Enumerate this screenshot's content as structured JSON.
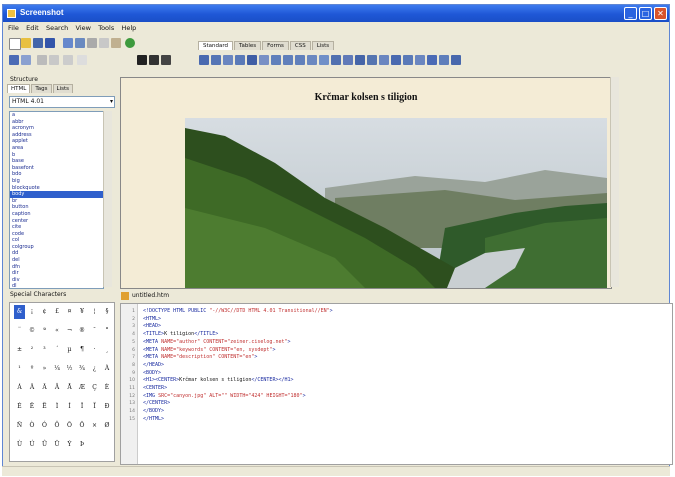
{
  "window": {
    "title": "Screenshot"
  },
  "menu": [
    "File",
    "Edit",
    "Search",
    "View",
    "Tools",
    "Help"
  ],
  "toolbar_tabs": {
    "labels": [
      "Standard",
      "Tables",
      "Forms",
      "CSS",
      "Lists"
    ],
    "active": 0
  },
  "left_panel": {
    "header": "Structure",
    "tabs": [
      "HTML",
      "Tags",
      "Lists"
    ],
    "dropdown_value": "HTML 4.01",
    "tags": [
      "a",
      "abbr",
      "acronym",
      "address",
      "applet",
      "area",
      "b",
      "base",
      "basefont",
      "bdo",
      "big",
      "blockquote",
      "body",
      "br",
      "button",
      "caption",
      "center",
      "cite",
      "code",
      "col",
      "colgroup",
      "dd",
      "del",
      "dfn",
      "dir",
      "div",
      "dl",
      "dt",
      "em",
      "fieldset",
      "font"
    ],
    "selected_index": 12
  },
  "editor": {
    "heading": "Krčmar kolsen s tiligion"
  },
  "char_panel": {
    "header": "Special Characters",
    "chars": [
      "&",
      "¡",
      "¢",
      "£",
      "¤",
      "¥",
      "¦",
      "§",
      "¨",
      "©",
      "ª",
      "«",
      "¬",
      "®",
      "¯",
      "°",
      "±",
      "²",
      "³",
      "´",
      "µ",
      "¶",
      "·",
      "¸",
      "¹",
      "º",
      "»",
      "¼",
      "½",
      "¾",
      "¿",
      "À",
      "Á",
      "Â",
      "Ã",
      "Ä",
      "Å",
      "Æ",
      "Ç",
      "È",
      "É",
      "Ê",
      "Ë",
      "Ì",
      "Í",
      "Î",
      "Ï",
      "Ð",
      "Ñ",
      "Ò",
      "Ó",
      "Ô",
      "Õ",
      "Ö",
      "×",
      "Ø",
      "Ù",
      "Ú",
      "Û",
      "Ü",
      "Ý",
      "Þ"
    ],
    "selected_index": 0
  },
  "code_panel": {
    "header": "untitled.htm",
    "lines": [
      [
        {
          "c": "t",
          "v": "<!DOCTYPE HTML PUBLIC "
        },
        {
          "c": "s",
          "v": "\"-//W3C//DTD HTML 4.01 Transitional//EN\""
        },
        {
          "c": "t",
          "v": ">"
        }
      ],
      [
        {
          "c": "t",
          "v": "<HTML>"
        }
      ],
      [
        {
          "c": "t",
          "v": "<HEAD>"
        }
      ],
      [
        {
          "c": "t",
          "v": "<TITLE>"
        },
        {
          "c": "x",
          "v": "K tiligion"
        },
        {
          "c": "t",
          "v": "</TITLE>"
        }
      ],
      [
        {
          "c": "t",
          "v": "<META "
        },
        {
          "c": "s",
          "v": "NAME=\"author\" CONTENT=\"zeiner.ciselog.net\""
        },
        {
          "c": "t",
          "v": ">"
        }
      ],
      [
        {
          "c": "t",
          "v": "<META "
        },
        {
          "c": "s",
          "v": "NAME=\"keywords\" CONTENT=\"en, sysdept\""
        },
        {
          "c": "t",
          "v": ">"
        }
      ],
      [
        {
          "c": "t",
          "v": "<META "
        },
        {
          "c": "s",
          "v": "NAME=\"description\" CONTENT=\"en\""
        },
        {
          "c": "t",
          "v": ">"
        }
      ],
      [
        {
          "c": "t",
          "v": "</HEAD>"
        }
      ],
      [
        {
          "c": "t",
          "v": "<BODY>"
        }
      ],
      [
        {
          "c": "t",
          "v": "<H1><CENTER>"
        },
        {
          "c": "x",
          "v": "Krčmar kolsen s tiligion"
        },
        {
          "c": "t",
          "v": "</CENTER></H1>"
        }
      ],
      [
        {
          "c": "t",
          "v": "<CENTER>"
        }
      ],
      [
        {
          "c": "t",
          "v": "<IMG "
        },
        {
          "c": "s",
          "v": "SRC=\"canyon.jpg\" ALT=\"\" WIDTH=\"424\" HEIGHT=\"180\""
        },
        {
          "c": "t",
          "v": ">"
        }
      ],
      [
        {
          "c": "t",
          "v": "</CENTER>"
        }
      ],
      [
        {
          "c": "t",
          "v": "</BODY>"
        }
      ],
      [
        {
          "c": "t",
          "v": "</HTML>"
        }
      ]
    ]
  },
  "colors": {
    "title_bar": "#1f57d6",
    "selection": "#2f5fcc",
    "chrome": "#ECE9D8",
    "editor_bg": "#f4ecd6"
  }
}
